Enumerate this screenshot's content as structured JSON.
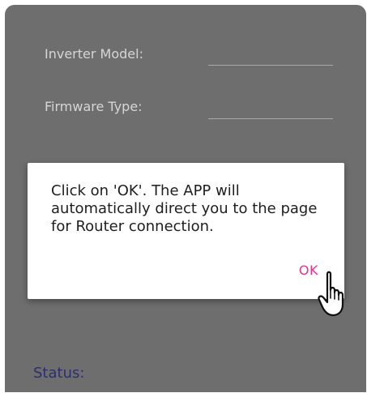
{
  "form": {
    "inverter_model_label": "Inverter Model:",
    "firmware_type_label": "Firmware Type:",
    "status_label": "Status:"
  },
  "dialog": {
    "message": "Click on 'OK'. The APP will automatically direct you to the page for Router connection.",
    "ok_label": "OK"
  },
  "colors": {
    "overlay_background": "#6e6e6e",
    "accent": "#e0358c",
    "status_text": "#2b2f6e"
  },
  "icons": {
    "pointer": "pointing-hand-icon"
  }
}
